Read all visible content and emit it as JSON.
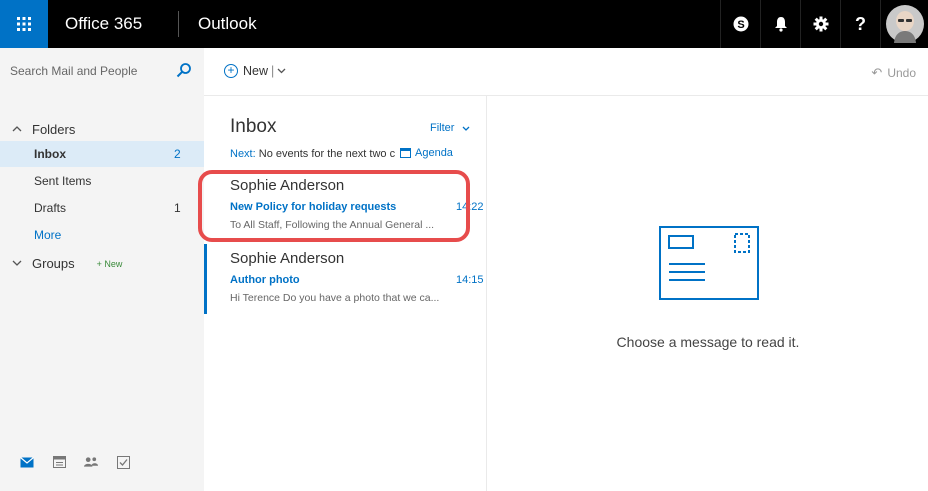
{
  "topbar": {
    "brand": "Office 365",
    "app": "Outlook",
    "icons": [
      "skype-icon",
      "bell-icon",
      "gear-icon",
      "help-icon"
    ],
    "help_label": "?",
    "accent_color": "#0072c6"
  },
  "search": {
    "placeholder": "Search Mail and People"
  },
  "toolbar": {
    "new_label": "New",
    "undo_label": "Undo"
  },
  "nav": {
    "folders_label": "Folders",
    "items": [
      {
        "label": "Inbox",
        "count": "2"
      },
      {
        "label": "Sent Items",
        "count": ""
      },
      {
        "label": "Drafts",
        "count": "1"
      }
    ],
    "more_label": "More",
    "groups_label": "Groups",
    "groups_new_label": "New"
  },
  "list": {
    "title": "Inbox",
    "filter_label": "Filter",
    "next_label": "Next:",
    "next_text": "No events for the next two c",
    "agenda_label": "Agenda",
    "messages": [
      {
        "sender": "Sophie Anderson",
        "subject": "New Policy for holiday requests",
        "time": "14:22",
        "preview": "To All Staff,  Following the Annual General ..."
      },
      {
        "sender": "Sophie Anderson",
        "subject": "Author photo",
        "time": "14:15",
        "preview": "Hi Terence  Do you have a photo that we ca..."
      }
    ]
  },
  "reading": {
    "empty_text": "Choose a message to read it."
  }
}
